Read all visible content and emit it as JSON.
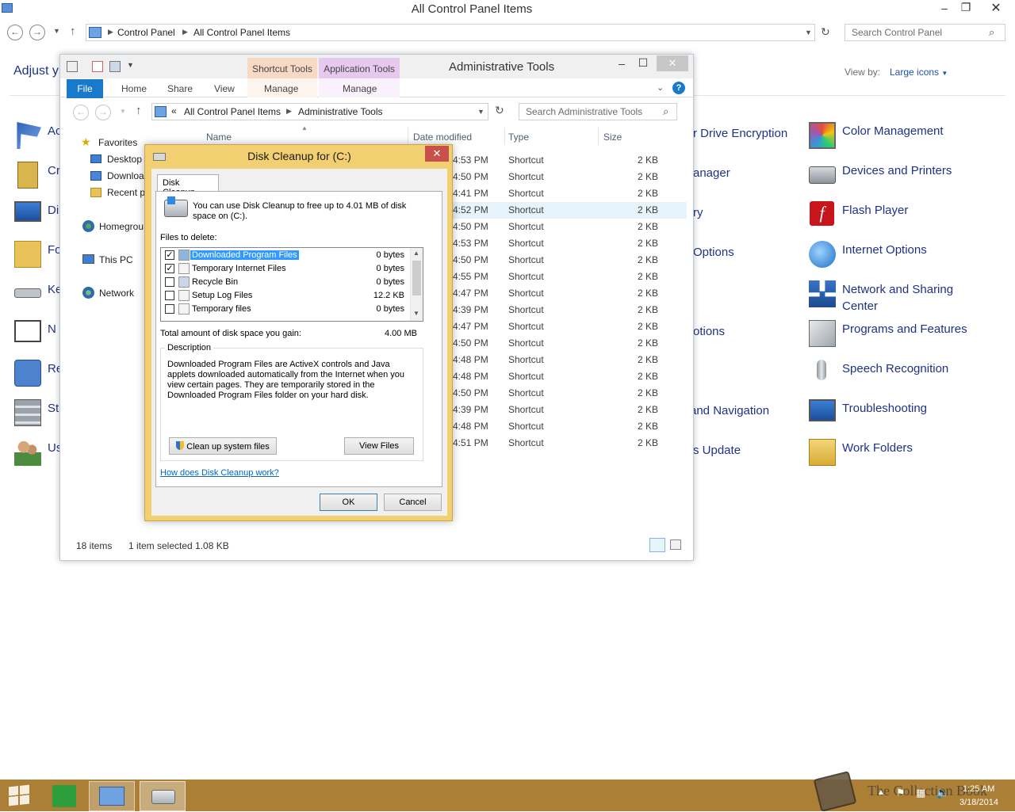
{
  "control_panel": {
    "title": "All Control Panel Items",
    "breadcrumb": [
      "Control Panel",
      "All Control Panel Items"
    ],
    "search_placeholder": "Search Control Panel",
    "adjust_heading": "Adjust y",
    "view_by_label": "View by:",
    "view_by_value": "Large icons",
    "left_items": [
      "Ac",
      "Cr",
      "Di",
      "Fo",
      "Ke",
      "N",
      "Re",
      "St",
      "Us"
    ],
    "mid_items": [
      "r Drive Encryption",
      "anager",
      "ry",
      "Options",
      "",
      "otions",
      "",
      "and Navigation",
      "s Update"
    ],
    "right_items": [
      "Color Management",
      "Devices and Printers",
      "Flash Player",
      "Internet Options",
      "Network and Sharing Center",
      "Programs and Features",
      "Speech Recognition",
      "Troubleshooting",
      "Work Folders"
    ]
  },
  "admin_tools": {
    "title": "Administrative Tools",
    "context_tab_shortcut": "Shortcut Tools",
    "context_tab_application": "Application Tools",
    "ribbon_tabs": [
      "File",
      "Home",
      "Share",
      "View",
      "Manage",
      "Manage"
    ],
    "breadcrumb_prefix": "«",
    "breadcrumb": [
      "All Control Panel Items",
      "Administrative Tools"
    ],
    "search_placeholder": "Search Administrative Tools",
    "nav_tree": [
      "Favorites",
      "Desktop",
      "Downloa",
      "Recent pl",
      "Homegrou",
      "This PC",
      "Network"
    ],
    "columns": [
      "Name",
      "Date modified",
      "Type",
      "Size"
    ],
    "rows": [
      {
        "time": "4:53 PM",
        "type": "Shortcut",
        "size": "2 KB"
      },
      {
        "time": "4:50 PM",
        "type": "Shortcut",
        "size": "2 KB"
      },
      {
        "time": "4:41 PM",
        "type": "Shortcut",
        "size": "2 KB"
      },
      {
        "time": "4:52 PM",
        "type": "Shortcut",
        "size": "2 KB"
      },
      {
        "time": "4:50 PM",
        "type": "Shortcut",
        "size": "2 KB"
      },
      {
        "time": "4:53 PM",
        "type": "Shortcut",
        "size": "2 KB"
      },
      {
        "time": "4:50 PM",
        "type": "Shortcut",
        "size": "2 KB"
      },
      {
        "time": "4:55 PM",
        "type": "Shortcut",
        "size": "2 KB"
      },
      {
        "time": "4:47 PM",
        "type": "Shortcut",
        "size": "2 KB"
      },
      {
        "time": "4:39 PM",
        "type": "Shortcut",
        "size": "2 KB"
      },
      {
        "time": "4:47 PM",
        "type": "Shortcut",
        "size": "2 KB"
      },
      {
        "time": "4:50 PM",
        "type": "Shortcut",
        "size": "2 KB"
      },
      {
        "time": "4:48 PM",
        "type": "Shortcut",
        "size": "2 KB"
      },
      {
        "time": "4:48 PM",
        "type": "Shortcut",
        "size": "2 KB"
      },
      {
        "time": "4:50 PM",
        "type": "Shortcut",
        "size": "2 KB"
      },
      {
        "time": "4:39 PM",
        "type": "Shortcut",
        "size": "2 KB"
      },
      {
        "time": "4:48 PM",
        "type": "Shortcut",
        "size": "2 KB"
      },
      {
        "time": "4:51 PM",
        "type": "Shortcut",
        "size": "2 KB"
      }
    ],
    "status_count": "18 items",
    "status_selected": "1 item selected  1.08 KB"
  },
  "disk_cleanup": {
    "title": "Disk Cleanup for  (C:)",
    "tab": "Disk Cleanup",
    "intro": "You can use Disk Cleanup to free up to 4.01 MB of disk space on  (C:).",
    "files_label": "Files to delete:",
    "files": [
      {
        "name": "Downloaded Program Files",
        "size": "0 bytes",
        "checked": true,
        "selected": true
      },
      {
        "name": "Temporary Internet Files",
        "size": "0 bytes",
        "checked": true,
        "selected": false
      },
      {
        "name": "Recycle Bin",
        "size": "0 bytes",
        "checked": false,
        "selected": false
      },
      {
        "name": "Setup Log Files",
        "size": "12.2 KB",
        "checked": false,
        "selected": false
      },
      {
        "name": "Temporary files",
        "size": "0 bytes",
        "checked": false,
        "selected": false
      }
    ],
    "total_label": "Total amount of disk space you gain:",
    "total_value": "4.00 MB",
    "description_legend": "Description",
    "description": "Downloaded Program Files are ActiveX controls and Java applets downloaded automatically from the Internet when you view certain pages. They are temporarily stored in the Downloaded Program Files folder on your hard disk.",
    "cleanup_system_button": "Clean up system files",
    "view_files_button": "View Files",
    "help_link": "How does Disk Cleanup work?",
    "ok_button": "OK",
    "cancel_button": "Cancel",
    "close_glyph": "✕"
  },
  "taskbar": {
    "watermark": "The Collection Book",
    "time": "1:25 AM",
    "date": "3/18/2014"
  },
  "colors": {
    "link": "#1e3287",
    "dialog_frame": "#f2cf70",
    "taskbar": "#ab8036",
    "selection": "#3399ff",
    "file_tab": "#1979ca"
  }
}
